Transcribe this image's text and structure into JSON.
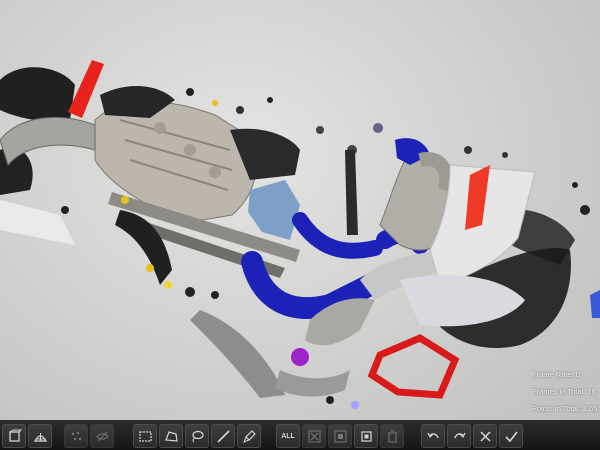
{
  "stats": {
    "frame_rate_label": "Frame Rate:",
    "frame_rate_value": "0",
    "frames_total_label": "Frames in Total:",
    "frames_total_value": "16",
    "points_total_label": "Points in Total:",
    "points_total_value": "2,65"
  },
  "toolbar": {
    "select_all_label": "ALL"
  },
  "colors": {
    "background": "#d2d3d1",
    "toolbar": "#1e1e1e",
    "hose_blue": "#1c22b8",
    "accent_red": "#e8231c",
    "metal": "#bdb6ac"
  }
}
